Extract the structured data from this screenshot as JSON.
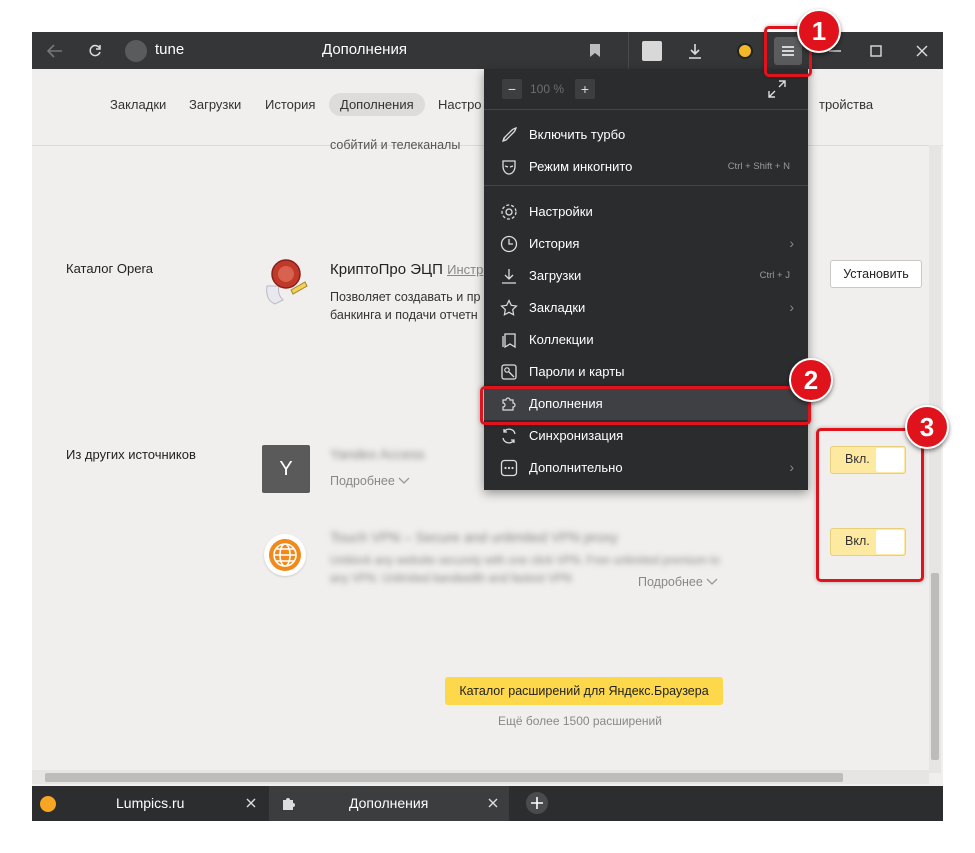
{
  "titlebar": {
    "site_name": "tune",
    "page_title": "Дополнения"
  },
  "nav_tabs": [
    "Закладки",
    "Загрузки",
    "История",
    "Дополнения",
    "Настро",
    "тройства"
  ],
  "sections": {
    "opera_catalog": "Каталог Opera",
    "other_sources": "Из других источников"
  },
  "extension_cryptopro": {
    "title": "КриптоПро ЭЦП",
    "instr_link": "Инстр",
    "desc_line1": "Позволяет создавать и пр",
    "desc_line2": "банкинга и подачи отчетн",
    "install_label": "Установить",
    "top_cut_text": "собйтий и телеканалы"
  },
  "extension_y": {
    "icon_letter": "Y",
    "title": "Yandex Access",
    "more_label": "Подробнее"
  },
  "extension_vpn": {
    "title": "Touch VPN – Secure and unlimited VPN proxy",
    "desc_line1": "Unblock any website securely with one click VPN. Free unlimited premium to",
    "desc_line2": "any VPN. Unlimited bandwidth and fastest VPN",
    "more_label": "Подробнее"
  },
  "toggle_label": "Вкл.",
  "catalog_button": "Каталог расширений для Яндекс.Браузера",
  "catalog_sub": "Ещё более 1500 расширений",
  "menu": {
    "zoom_value": "100 %",
    "zoom_minus": "−",
    "zoom_plus": "+",
    "items": [
      {
        "label": "Включить турбо",
        "shortcut": "",
        "arrow": false
      },
      {
        "label": "Режим инкогнито",
        "shortcut": "Ctrl + Shift + N",
        "arrow": false
      },
      {
        "label": "Настройки",
        "shortcut": "",
        "arrow": false
      },
      {
        "label": "История",
        "shortcut": "",
        "arrow": true
      },
      {
        "label": "Загрузки",
        "shortcut": "Ctrl + J",
        "arrow": false
      },
      {
        "label": "Закладки",
        "shortcut": "",
        "arrow": true
      },
      {
        "label": "Коллекции",
        "shortcut": "",
        "arrow": false
      },
      {
        "label": "Пароли и карты",
        "shortcut": "",
        "arrow": false
      },
      {
        "label": "Дополнения",
        "shortcut": "",
        "arrow": false
      },
      {
        "label": "Синхронизация",
        "shortcut": "",
        "arrow": false
      },
      {
        "label": "Дополнительно",
        "shortcut": "",
        "arrow": true
      }
    ]
  },
  "bottom_tabs": [
    {
      "label": "Lumpics.ru"
    },
    {
      "label": "Дополнения"
    }
  ],
  "badges": [
    "1",
    "2",
    "3"
  ],
  "colors": {
    "annotation_red": "#e0121c",
    "toggle_yellow": "#fde9a0",
    "catalog_yellow": "#fcd84a",
    "menu_bg": "#2b2c2e"
  }
}
